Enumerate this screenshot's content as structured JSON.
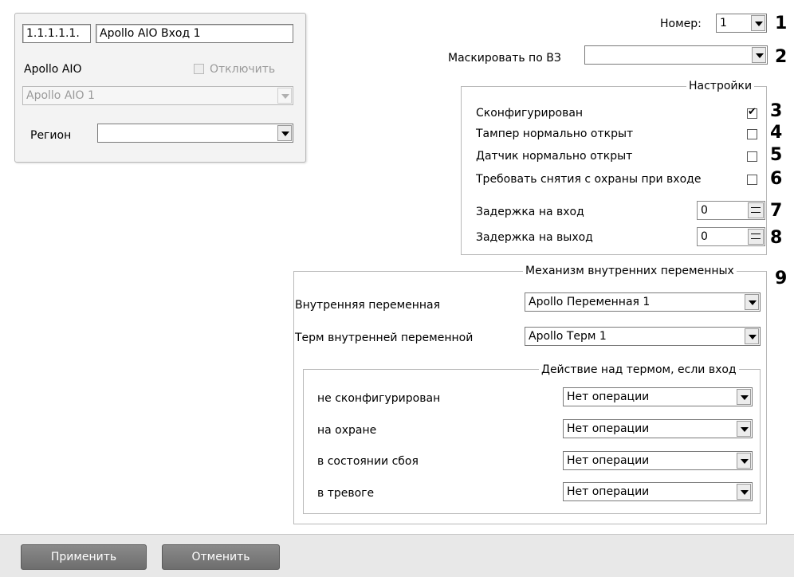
{
  "object_panel": {
    "id_value": "1.1.1.1.1.",
    "name_value": "Apollo AIO Вход 1",
    "parent_label": "Apollo AIO",
    "disable_label": "Отключить",
    "parent_combo_value": "Apollo AIO 1",
    "region_label": "Регион",
    "region_value": ""
  },
  "top": {
    "number_label": "Номер:",
    "number_value": "1",
    "mask_label": "Маскировать по ВЗ",
    "mask_value": ""
  },
  "settings": {
    "title": "Настройки",
    "configured_label": "Сконфигурирован",
    "configured_checked": true,
    "tamper_label": "Тампер нормально открыт",
    "sensor_label": "Датчик нормально открыт",
    "disarm_label": "Требовать снятия с охраны при входе",
    "entry_delay_label": "Задержка на вход",
    "entry_delay_value": "0",
    "exit_delay_label": "Задержка на выход",
    "exit_delay_value": "0"
  },
  "vars": {
    "title": "Механизм внутренних переменных",
    "var_label": "Внутренняя переменная",
    "var_value": "Apollo Переменная 1",
    "term_label": "Терм внутренней переменной",
    "term_value": "Apollo Терм 1",
    "action_title": "Действие над термом, если вход",
    "rows": [
      {
        "label": "не сконфигурирован",
        "value": "Нет операции"
      },
      {
        "label": "на охране",
        "value": "Нет операции"
      },
      {
        "label": "в состоянии сбоя",
        "value": "Нет операции"
      },
      {
        "label": "в тревоге",
        "value": "Нет операции"
      }
    ]
  },
  "callouts": [
    "1",
    "2",
    "3",
    "4",
    "5",
    "6",
    "7",
    "8",
    "9"
  ],
  "buttons": {
    "apply": "Применить",
    "cancel": "Отменить"
  }
}
